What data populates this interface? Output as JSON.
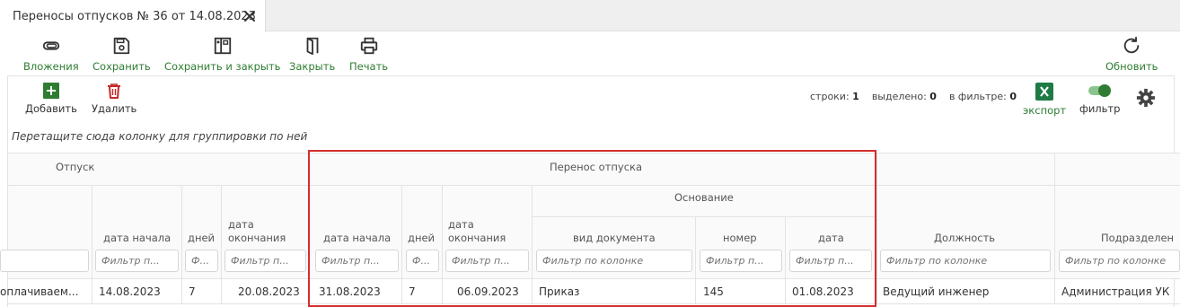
{
  "tab": {
    "title": "Переносы отпусков № 36 от 14.08.2023"
  },
  "toolbar": {
    "attachments": "Вложения",
    "save": "Сохранить",
    "save_close": "Сохранить и закрыть",
    "close": "Закрыть",
    "print": "Печать",
    "refresh": "Обновить"
  },
  "panel_toolbar": {
    "add": "Добавить",
    "delete": "Удалить",
    "export": "экспорт",
    "filter": "фильтр",
    "filter_enabled": true
  },
  "stats": {
    "rows_label": "строки:",
    "rows": "1",
    "selected_label": "выделено:",
    "selected": "0",
    "filtered_label": "в фильтре:",
    "filtered": "0"
  },
  "grid": {
    "group_hint": "Перетащите сюда колонку для группировки по ней",
    "bands": {
      "vacation": "Отпуск",
      "transfer": "Перенос отпуска",
      "basis": "Основание"
    },
    "columns": {
      "start": "дата начала",
      "days": "дней",
      "end_line1": "дата",
      "end_line2": "окончания",
      "doc_type": "вид документа",
      "number": "номер",
      "date": "дата",
      "position": "Должность",
      "department": "Подразделен"
    },
    "filters": {
      "c0": "",
      "c1": "Фильтр п...",
      "c2": "Ф...",
      "c3": "Фильтр п...",
      "c4": "Фильтр п...",
      "c5": "Ф...",
      "c6": "Фильтр п...",
      "c7": "Фильтр по колонке",
      "c8": "Фильтр п...",
      "c9": "Фильтр п...",
      "c10": "Фильтр по колонке",
      "c11": "Фильтр по колонке"
    },
    "row": {
      "c0": "оплачиваем...",
      "c1": "14.08.2023",
      "c2": "7",
      "c3": "20.08.2023",
      "c4": "31.08.2023",
      "c5": "7",
      "c6": "06.09.2023",
      "c7": "Приказ",
      "c8": "145",
      "c9": "01.08.2023",
      "c10": "Ведущий инженер",
      "c11": "Администрация УК"
    }
  },
  "colors": {
    "accent": "#2e7d32",
    "delete": "#c62828",
    "highlight": "#d32f2f",
    "excel": "#1e7b45"
  }
}
